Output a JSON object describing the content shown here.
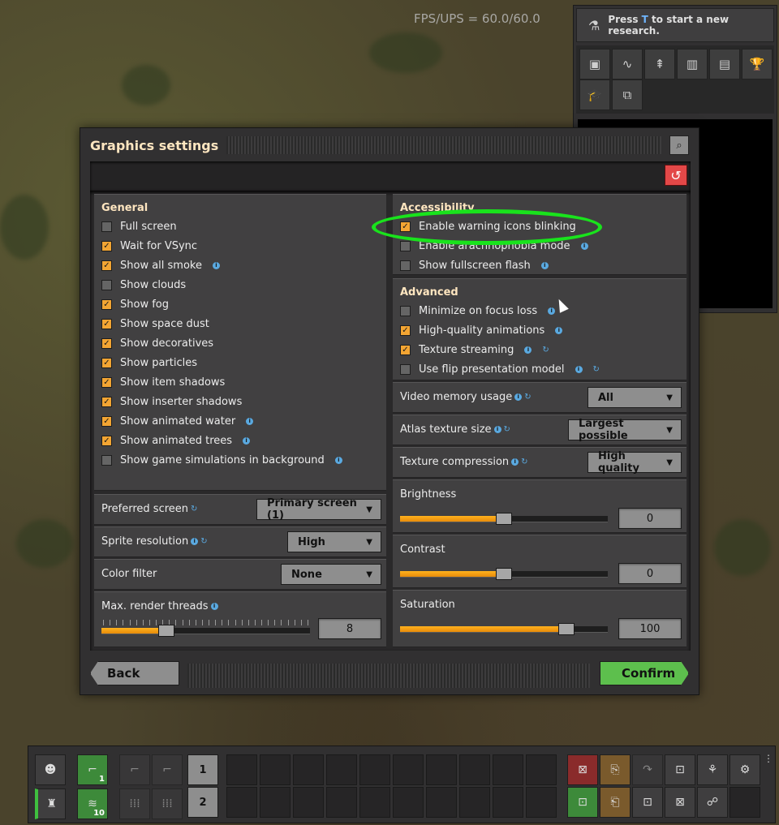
{
  "fps": "FPS/UPS = 60.0/60.0",
  "research": {
    "prompt_pre": "Press",
    "prompt_key": "T",
    "prompt_post": "to start a new research."
  },
  "dialog": {
    "title": "Graphics settings",
    "general": {
      "title": "General",
      "options": [
        {
          "label": "Full screen",
          "checked": false,
          "info": false
        },
        {
          "label": "Wait for VSync",
          "checked": true,
          "info": false
        },
        {
          "label": "Show all smoke",
          "checked": true,
          "info": true
        },
        {
          "label": "Show clouds",
          "checked": false,
          "info": false
        },
        {
          "label": "Show fog",
          "checked": true,
          "info": false
        },
        {
          "label": "Show space dust",
          "checked": true,
          "info": false
        },
        {
          "label": "Show decoratives",
          "checked": true,
          "info": false
        },
        {
          "label": "Show particles",
          "checked": true,
          "info": false
        },
        {
          "label": "Show item shadows",
          "checked": true,
          "info": false
        },
        {
          "label": "Show inserter shadows",
          "checked": true,
          "info": false
        },
        {
          "label": "Show animated water",
          "checked": true,
          "info": true
        },
        {
          "label": "Show animated trees",
          "checked": true,
          "info": true
        },
        {
          "label": "Show game simulations in background",
          "checked": false,
          "info": true
        }
      ]
    },
    "preferred_screen": {
      "label": "Preferred screen",
      "value": "Primary screen (1)"
    },
    "sprite_resolution": {
      "label": "Sprite resolution",
      "value": "High"
    },
    "color_filter": {
      "label": "Color filter",
      "value": "None"
    },
    "render_threads": {
      "label": "Max. render threads",
      "value": "8",
      "fraction": 0.31
    },
    "accessibility": {
      "title": "Accessibility",
      "options": [
        {
          "label": "Enable warning icons blinking",
          "checked": true
        },
        {
          "label": "Enable arachnophobia mode",
          "checked": false
        },
        {
          "label": "Show fullscreen flash",
          "checked": false
        }
      ]
    },
    "advanced": {
      "title": "Advanced",
      "options": [
        {
          "label": "Minimize on focus loss",
          "checked": false
        },
        {
          "label": "High-quality animations",
          "checked": true
        },
        {
          "label": "Texture streaming",
          "checked": true
        },
        {
          "label": "Use flip presentation model",
          "checked": false
        }
      ]
    },
    "video_memory": {
      "label": "Video memory usage",
      "value": "All"
    },
    "atlas_size": {
      "label": "Atlas texture size",
      "value": "Largest possible"
    },
    "texture_compression": {
      "label": "Texture compression",
      "value": "High quality"
    },
    "brightness": {
      "label": "Brightness",
      "value": "0",
      "fraction": 0.5
    },
    "contrast": {
      "label": "Contrast",
      "value": "0",
      "fraction": 0.5
    },
    "saturation": {
      "label": "Saturation",
      "value": "100",
      "fraction": 0.8
    },
    "back": "Back",
    "confirm": "Confirm"
  },
  "toolbar": {
    "hotkeys": [
      "1",
      "2"
    ],
    "counts": {
      "pistol": "1",
      "ammo": "10"
    }
  },
  "colors": {
    "accent": "#f3a533",
    "confirm": "#5dbf4d",
    "highlight": "#19e31c",
    "reset": "#e34848"
  }
}
